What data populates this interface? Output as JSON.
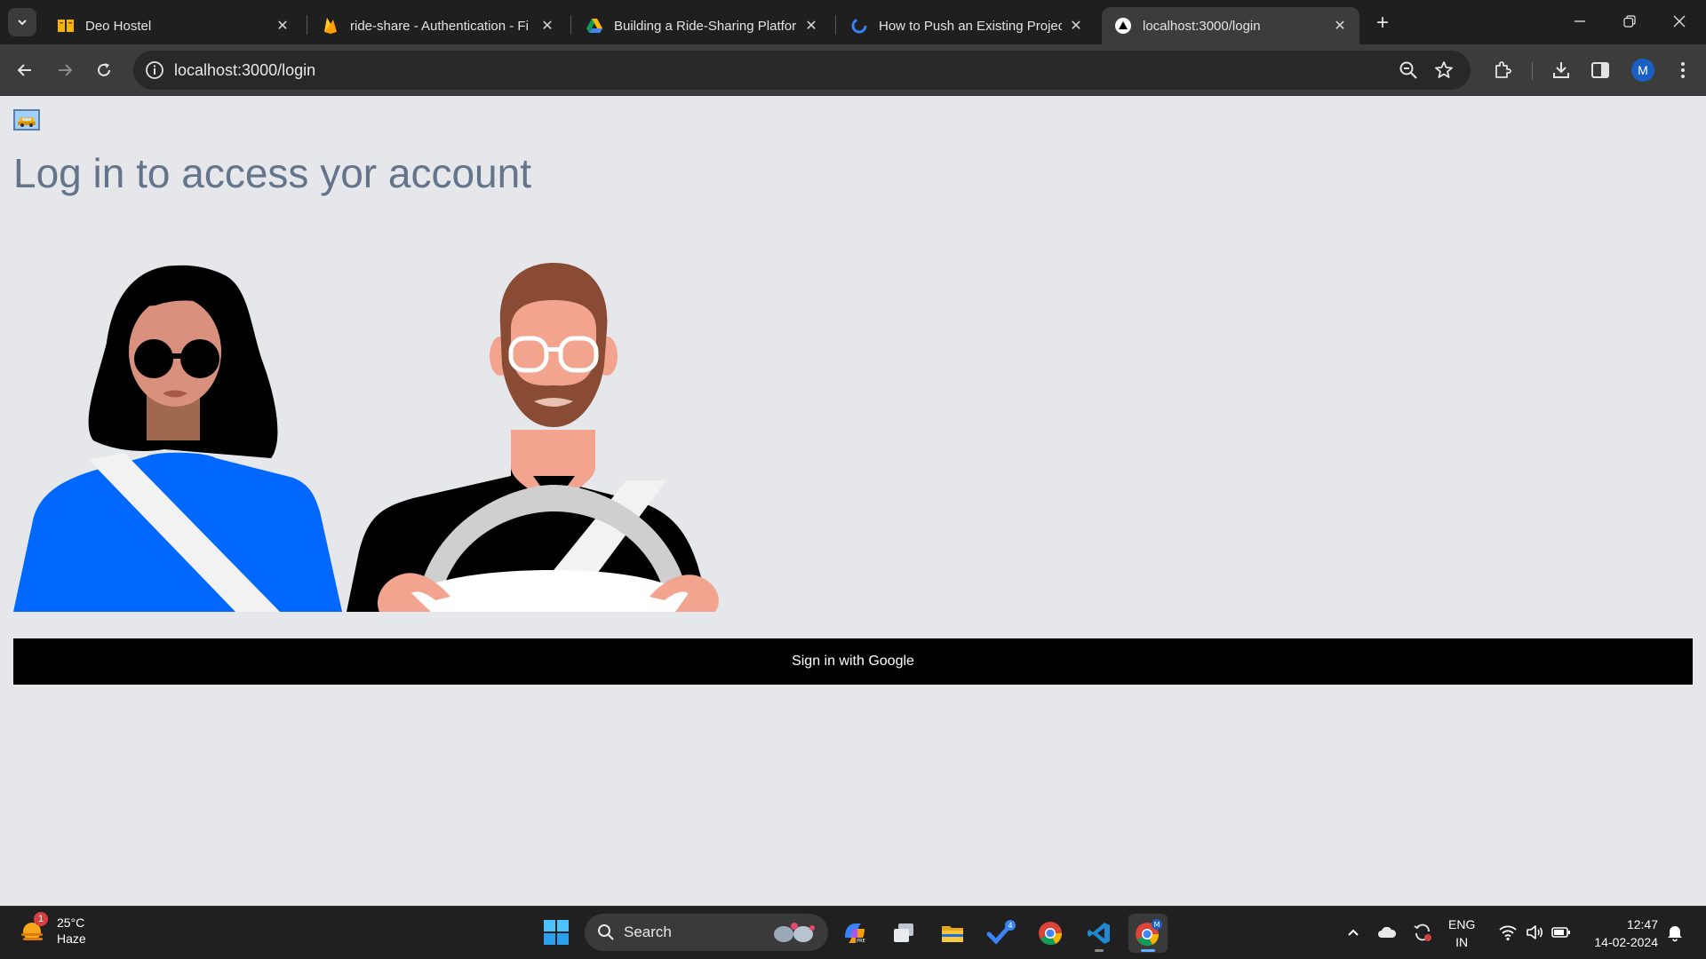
{
  "browser": {
    "tabs": [
      {
        "title": "Deo Hostel",
        "favicon": "book-icon",
        "active": false
      },
      {
        "title": "ride-share - Authentication - Fi",
        "favicon": "firebase-icon",
        "active": false
      },
      {
        "title": "Building a Ride-Sharing Platforr",
        "favicon": "google-drive-icon",
        "active": false
      },
      {
        "title": "How to Push an Existing Project",
        "favicon": "refresh-sync-icon",
        "active": false
      },
      {
        "title": "localhost:3000/login",
        "favicon": "triangle-icon",
        "active": true
      }
    ],
    "address": "localhost:3000/login",
    "profile_initial": "M"
  },
  "page": {
    "heading": "Log in to access yor account",
    "signin_label": "Sign in with Google"
  },
  "taskbar": {
    "weather": {
      "temp": "25°C",
      "condition": "Haze",
      "badge": "1"
    },
    "search_label": "Search",
    "todo_badge": "4",
    "lang_top": "ENG",
    "lang_bottom": "IN",
    "time": "12:47",
    "date": "14-02-2024"
  },
  "colors": {
    "page_bg": "#e5e7eb",
    "heading": "#64748b",
    "button_bg": "#000000",
    "passenger_shirt": "#006aff"
  }
}
